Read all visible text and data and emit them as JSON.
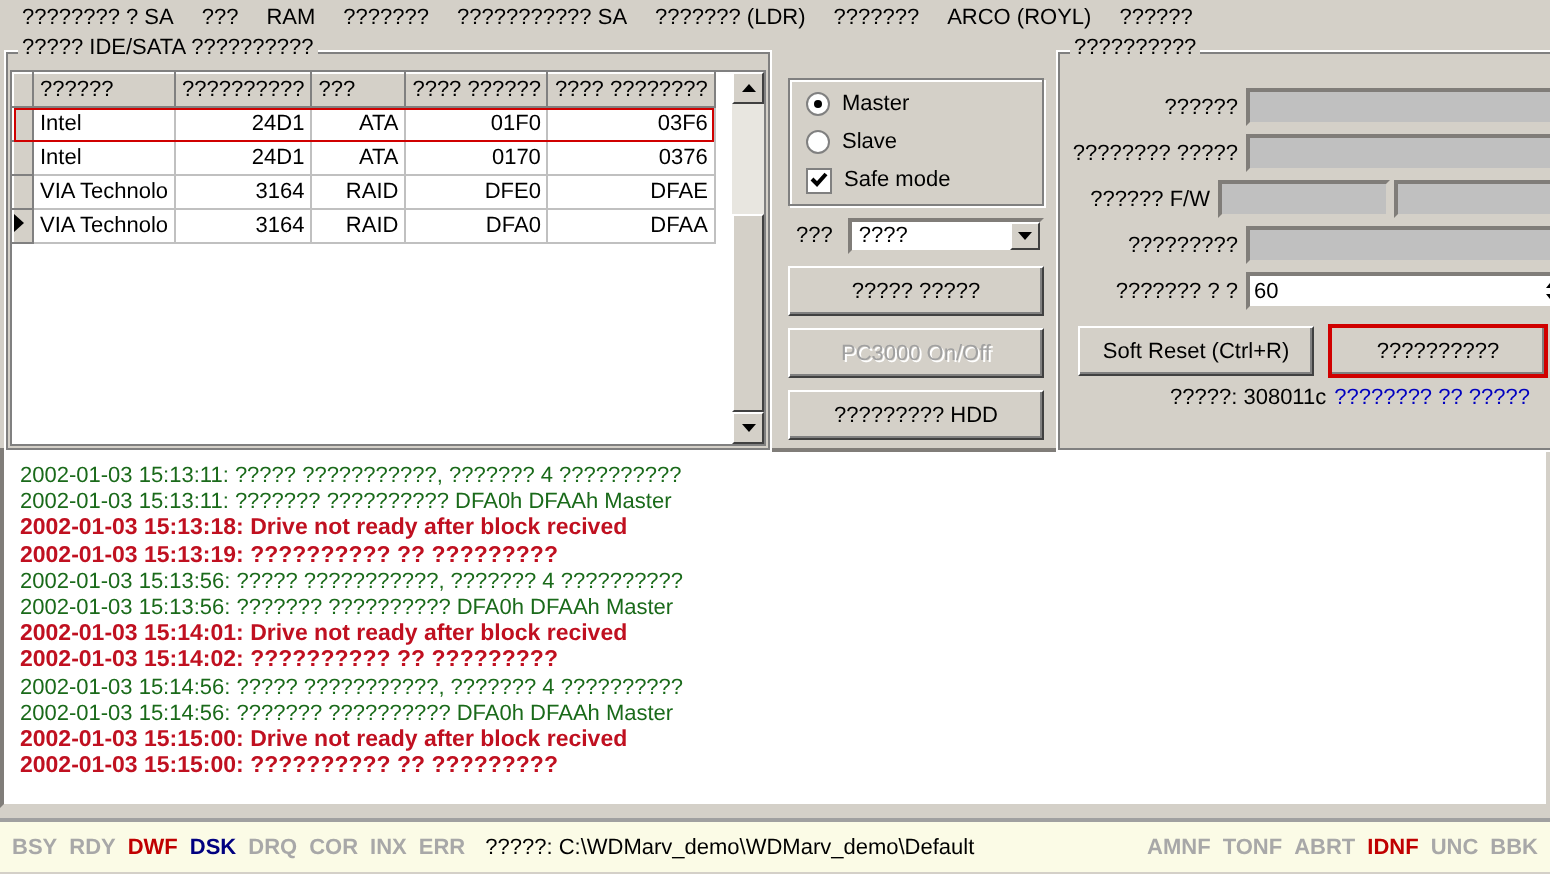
{
  "menu": [
    {
      "label": "???????? ? SA"
    },
    {
      "label": "???"
    },
    {
      "label": "RAM"
    },
    {
      "label": "???????"
    },
    {
      "label": "??????????? SA"
    },
    {
      "label": "??????? (LDR)"
    },
    {
      "label": "???????"
    },
    {
      "label": "ARCO (ROYL)"
    },
    {
      "label": "??????"
    }
  ],
  "controllers": {
    "title": "????? IDE/SATA ??????????",
    "columns": [
      "??????",
      "??????????",
      "???",
      "???? ??????",
      "???? ????????"
    ],
    "rows": [
      {
        "cells": [
          "Intel",
          "24D1",
          "ATA",
          "01F0",
          "03F6"
        ],
        "selected": true,
        "current": false
      },
      {
        "cells": [
          "Intel",
          "24D1",
          "ATA",
          "0170",
          "0376"
        ],
        "selected": false,
        "current": false
      },
      {
        "cells": [
          "VIA Technolo",
          "3164",
          "RAID",
          "DFE0",
          "DFAE"
        ],
        "selected": false,
        "current": false
      },
      {
        "cells": [
          "VIA Technolo",
          "3164",
          "RAID",
          "DFA0",
          "DFAA"
        ],
        "selected": false,
        "current": true
      }
    ]
  },
  "mode": {
    "options": [
      {
        "label": "Master",
        "selected": true
      },
      {
        "label": "Slave",
        "selected": false
      }
    ],
    "safe_mode": {
      "label": "Safe mode",
      "checked": true
    }
  },
  "port": {
    "label": "???",
    "value": "????"
  },
  "actions": [
    {
      "label": "????? ?????",
      "disabled": false
    },
    {
      "label": "PC3000 On/Off",
      "disabled": true
    },
    {
      "label": "????????? HDD",
      "disabled": false
    }
  ],
  "drive": {
    "title": "??????????",
    "fields": [
      {
        "label": "??????",
        "kind": "single"
      },
      {
        "label": "???????? ?????",
        "kind": "single"
      },
      {
        "label": "?????? F/W",
        "kind": "double"
      },
      {
        "label": "?????????",
        "kind": "single"
      },
      {
        "label": "??????? ? ?",
        "kind": "spin",
        "value": "60"
      }
    ],
    "buttons": [
      {
        "label": "Soft Reset (Ctrl+R)",
        "focused": false
      },
      {
        "label": "??????????",
        "focused": true
      }
    ],
    "version": "?????: 308011c",
    "link": "???????? ?? ?????"
  },
  "log": [
    {
      "text": "2002-01-03 15:13:11: ????? ???????????, ??????? 4 ??????????",
      "kind": "info"
    },
    {
      "text": "2002-01-03 15:13:11: ??????? ?????????? DFA0h DFAAh Master",
      "kind": "info"
    },
    {
      "text": "2002-01-03 15:13:18: Drive not ready after block recived",
      "kind": "error"
    },
    {
      "text": "2002-01-03 15:13:19: ?????????? ?? ?????????",
      "kind": "error"
    },
    {
      "text": "2002-01-03 15:13:56: ????? ???????????, ??????? 4 ??????????",
      "kind": "info"
    },
    {
      "text": "2002-01-03 15:13:56: ??????? ?????????? DFA0h DFAAh Master",
      "kind": "info"
    },
    {
      "text": "2002-01-03 15:14:01: Drive not ready after block recived",
      "kind": "error"
    },
    {
      "text": "2002-01-03 15:14:02: ?????????? ?? ?????????",
      "kind": "error"
    },
    {
      "text": "2002-01-03 15:14:56: ????? ???????????, ??????? 4 ??????????",
      "kind": "info"
    },
    {
      "text": "2002-01-03 15:14:56: ??????? ?????????? DFA0h DFAAh Master",
      "kind": "info"
    },
    {
      "text": "2002-01-03 15:15:00: Drive not ready after block recived",
      "kind": "error"
    },
    {
      "text": "2002-01-03 15:15:00: ?????????? ?? ?????????",
      "kind": "error"
    }
  ],
  "status_bar": {
    "flags_left": [
      {
        "label": "BSY",
        "color": "#a8a8a8"
      },
      {
        "label": "RDY",
        "color": "#a8a8a8"
      },
      {
        "label": "DWF",
        "color": "#c00000"
      },
      {
        "label": "DSK",
        "color": "#000080"
      },
      {
        "label": "DRQ",
        "color": "#a8a8a8"
      },
      {
        "label": "COR",
        "color": "#a8a8a8"
      },
      {
        "label": "INX",
        "color": "#a8a8a8"
      },
      {
        "label": "ERR",
        "color": "#a8a8a8"
      }
    ],
    "path": "?????: C:\\WDMarv_demo\\WDMarv_demo\\Default",
    "flags_right": [
      {
        "label": "AMNF",
        "color": "#a8a8a8"
      },
      {
        "label": "TONF",
        "color": "#a8a8a8"
      },
      {
        "label": "ABRT",
        "color": "#a8a8a8"
      },
      {
        "label": "IDNF",
        "color": "#c00000"
      },
      {
        "label": "UNC",
        "color": "#a8a8a8"
      },
      {
        "label": "BBK",
        "color": "#a8a8a8"
      }
    ]
  }
}
